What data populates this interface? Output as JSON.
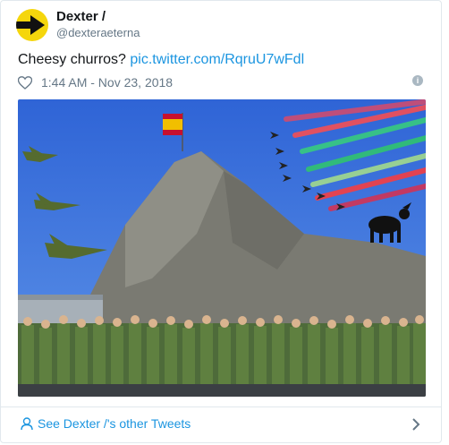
{
  "tweet": {
    "author_name": "Dexter /",
    "author_handle": "@dexteraeterna",
    "text": "Cheesy churros?",
    "link_text": "pic.twitter.com/RqruU7wFdl",
    "timestamp": "1:44 AM - Nov 23, 2018"
  },
  "footer": {
    "see_more": "See Dexter /'s other Tweets"
  },
  "icons": {
    "avatar": "arrow-avatar-icon",
    "like": "heart-icon",
    "info": "info-icon",
    "user": "user-icon",
    "chevron": "chevron-right-icon"
  },
  "colors": {
    "link": "#1b95e0",
    "avatar_bg": "#f5d60c",
    "text": "#14171a",
    "muted": "#657786"
  }
}
